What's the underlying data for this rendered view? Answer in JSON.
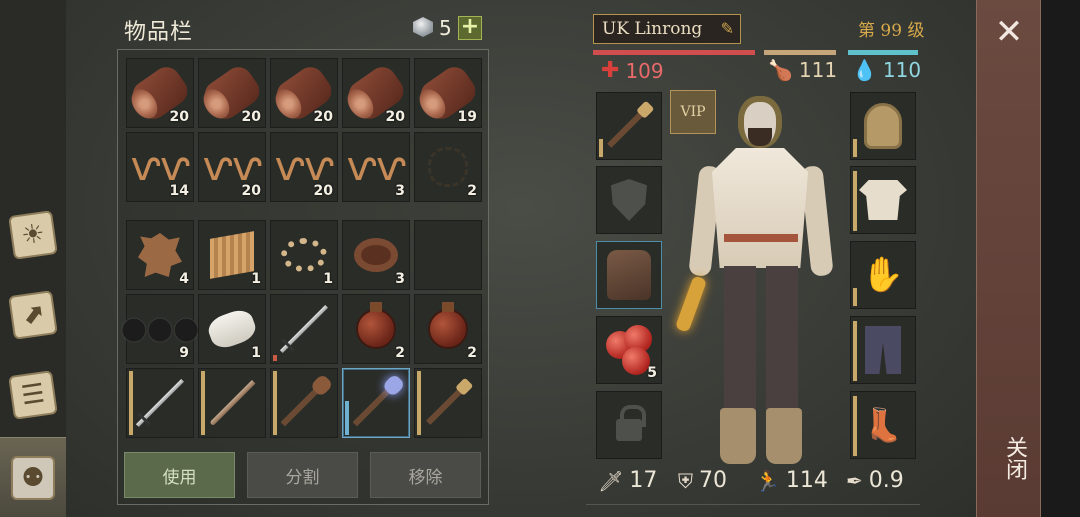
{
  "inventory": {
    "title": "物品栏",
    "gem_count": "5",
    "add_label": "+",
    "rows": [
      [
        {
          "icon": "log-icon",
          "qty": "20"
        },
        {
          "icon": "log-icon",
          "qty": "20"
        },
        {
          "icon": "log-icon",
          "qty": "20"
        },
        {
          "icon": "log-icon",
          "qty": "20"
        },
        {
          "icon": "log-icon",
          "qty": "19"
        }
      ],
      [
        {
          "icon": "plant-fiber-icon",
          "qty": "14"
        },
        {
          "icon": "plant-fiber-icon",
          "qty": "20"
        },
        {
          "icon": "plant-fiber-icon",
          "qty": "20"
        },
        {
          "icon": "plant-fiber-icon",
          "qty": "3"
        },
        {
          "icon": "string-icon",
          "qty": "2"
        }
      ],
      [
        {
          "icon": "raw-hide-icon",
          "qty": "4"
        },
        {
          "icon": "cloth-icon",
          "qty": "1"
        },
        {
          "icon": "rope-icon",
          "qty": "1"
        },
        {
          "icon": "leather-strap-icon",
          "qty": "3"
        },
        {
          "icon": "empty-slot",
          "qty": ""
        }
      ],
      [
        {
          "icon": "coal-icon",
          "qty": "9"
        },
        {
          "icon": "bandage-icon",
          "qty": "1"
        },
        {
          "icon": "sword-icon",
          "qty": ""
        },
        {
          "icon": "water-flask-icon",
          "qty": "2"
        },
        {
          "icon": "water-flask-icon",
          "qty": "2"
        }
      ],
      [
        {
          "icon": "sword-icon",
          "qty": ""
        },
        {
          "icon": "sabre-icon",
          "qty": ""
        },
        {
          "icon": "mace-icon",
          "qty": ""
        },
        {
          "icon": "enchanted-mace-icon",
          "qty": ""
        },
        {
          "icon": "torch-icon",
          "qty": ""
        }
      ]
    ],
    "buttons": {
      "use": "使用",
      "split": "分割",
      "remove": "移除"
    }
  },
  "character": {
    "name": "UK Linrong",
    "level": "第 99 级",
    "vip": "VIP",
    "health": "109",
    "food": "111",
    "water": "110",
    "food_ratio": 0.95,
    "water_ratio": 0.95,
    "health_ratio": 1.0,
    "food_slot_qty": "5",
    "stats": {
      "attack": "17",
      "armor": "70",
      "speed": "114",
      "weight": "0.9"
    }
  },
  "close": {
    "label": "关闭"
  },
  "colors": {
    "health": "#d04e4e",
    "food": "#c7a57a",
    "water": "#5fc1cc",
    "level": "#d6a94a",
    "accent_green": "#5c6a2f"
  }
}
